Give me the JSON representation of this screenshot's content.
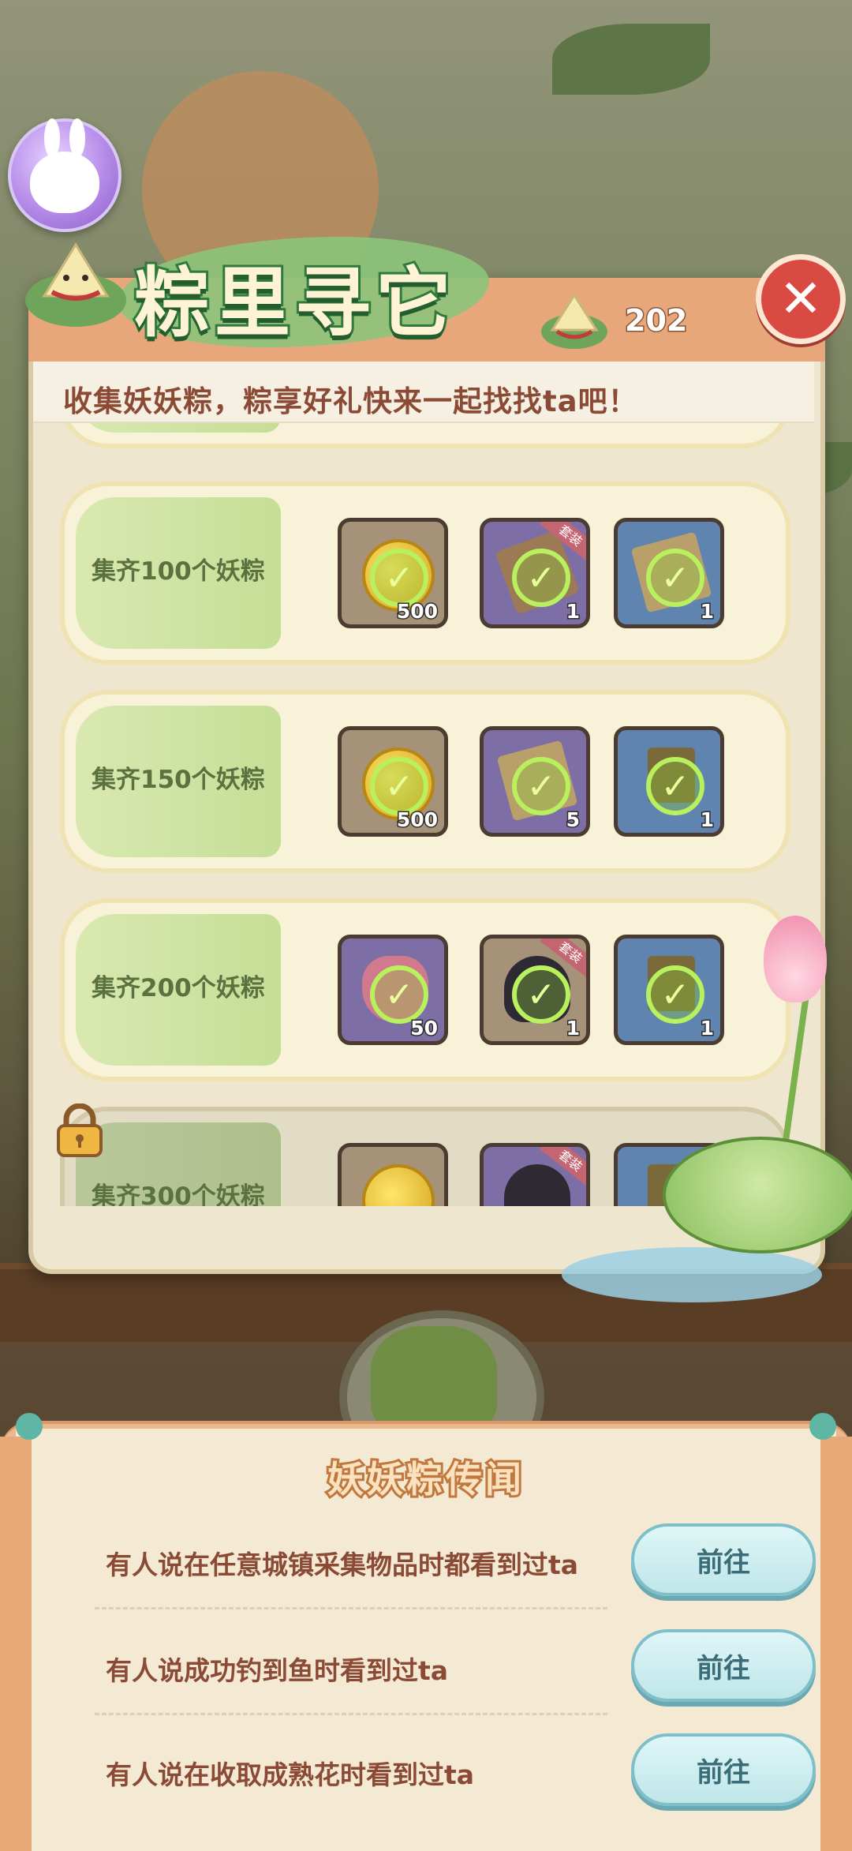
{
  "colors": {
    "accent_green": "#2f7a3c",
    "header": "#e8a77b",
    "text_brown": "#8b4a35",
    "close_red": "#d94a43",
    "check_green": "#b8f05e",
    "go_button": "#bfe6ea"
  },
  "header": {
    "title": "粽里寻它",
    "subtitle": "收集妖妖粽，粽享好礼快来一起找找ta吧！",
    "counter_value": "202",
    "counter_icon": "zongzi-icon",
    "close_icon": "close-icon",
    "close_label": "✕"
  },
  "tiers": [
    {
      "label": "集齐100个妖粽",
      "locked": false,
      "rewards": [
        {
          "icon": "gold-coin-icon",
          "qty": "500",
          "claimed": true,
          "frame": "bronze",
          "tag": ""
        },
        {
          "icon": "outfit-icon",
          "qty": "1",
          "claimed": true,
          "frame": "purple",
          "tag": "套装"
        },
        {
          "icon": "furniture-icon",
          "qty": "1",
          "claimed": true,
          "frame": "blue",
          "tag": ""
        }
      ]
    },
    {
      "label": "集齐150个妖粽",
      "locked": false,
      "rewards": [
        {
          "icon": "gold-coin-icon",
          "qty": "500",
          "claimed": true,
          "frame": "bronze",
          "tag": ""
        },
        {
          "icon": "ticket-icon",
          "qty": "5",
          "claimed": true,
          "frame": "purple",
          "tag": ""
        },
        {
          "icon": "furniture-icon",
          "qty": "1",
          "claimed": true,
          "frame": "blue",
          "tag": ""
        }
      ]
    },
    {
      "label": "集齐200个妖粽",
      "locked": false,
      "rewards": [
        {
          "icon": "heart-icon",
          "qty": "50",
          "claimed": true,
          "frame": "purple",
          "tag": ""
        },
        {
          "icon": "outfit-icon",
          "qty": "1",
          "claimed": true,
          "frame": "bronze",
          "tag": "套装"
        },
        {
          "icon": "chair-icon",
          "qty": "1",
          "claimed": true,
          "frame": "blue",
          "tag": ""
        }
      ]
    },
    {
      "label": "集齐300个妖粽",
      "locked": true,
      "rewards": [
        {
          "icon": "gold-coin-icon",
          "qty": "",
          "claimed": false,
          "frame": "bronze",
          "tag": ""
        },
        {
          "icon": "hairstyle-icon",
          "qty": "",
          "claimed": false,
          "frame": "purple",
          "tag": "套装"
        },
        {
          "icon": "furniture-icon",
          "qty": "",
          "claimed": false,
          "frame": "blue",
          "tag": ""
        }
      ]
    }
  ],
  "rumors": {
    "title": "妖妖粽传闻",
    "items": [
      {
        "text": "有人说在任意城镇采集物品时都看到过ta",
        "button": "前往"
      },
      {
        "text": "有人说成功钓到鱼时看到过ta",
        "button": "前往"
      },
      {
        "text": "有人说在收取成熟花时看到过ta",
        "button": "前往"
      }
    ]
  }
}
